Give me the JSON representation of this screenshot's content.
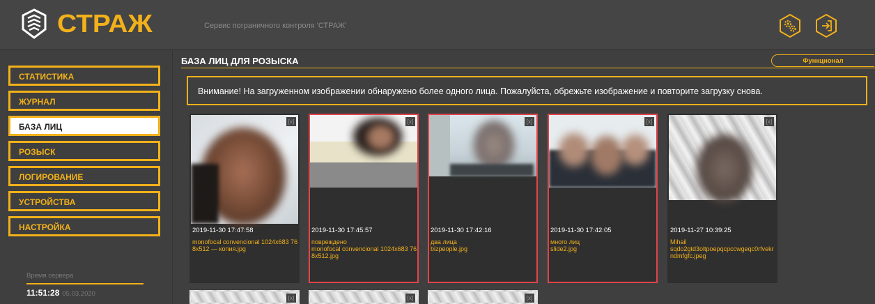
{
  "header": {
    "brand": "СТРАЖ",
    "service_title": "Сервис пограничного контроля 'СТРАЖ'",
    "icons": [
      "settings-gears-icon",
      "logout-icon"
    ]
  },
  "sidebar": {
    "items": [
      {
        "label": "СТАТИСТИКА",
        "active": false
      },
      {
        "label": "ЖУРНАЛ",
        "active": false
      },
      {
        "label": "БАЗА ЛИЦ",
        "active": true
      },
      {
        "label": "РОЗЫСК",
        "active": false
      },
      {
        "label": "ЛОГИРОВАНИЕ",
        "active": false
      },
      {
        "label": "УСТРОЙСТВА",
        "active": false
      },
      {
        "label": "НАСТРОЙКА",
        "active": false
      }
    ],
    "server_time_label": "Время сервера",
    "server_time": "11:51:28",
    "server_date": "05.03.2020"
  },
  "main": {
    "title": "БАЗА ЛИЦ ДЛЯ РОЗЫСКА",
    "functional_button": "Функционал",
    "warning": "Внимание! На загруженном изображении обнаружено более одного лица. Пожалуйста, обрежьте изображение и повторите загрузку снова.",
    "close_label": "[x]",
    "cards": [
      {
        "date": "2019-11-30 17:47:58",
        "status": "",
        "file": "monofocal convencional 1024x683 768x512 — копия.jpg",
        "error": false
      },
      {
        "date": "2019-11-30 17:45:57",
        "status": "повреждено",
        "file": "monofocal convencional 1024x683 768x512.jpg",
        "error": true
      },
      {
        "date": "2019-11-30 17:42:16",
        "status": "два лица",
        "file": "bizpeople.jpg",
        "error": true
      },
      {
        "date": "2019-11-30 17:42:05",
        "status": "много лиц",
        "file": "slide2.jpg",
        "error": true
      },
      {
        "date": "2019-11-27 10:39:25",
        "status": "Mihail",
        "file": "sqdo2gtd3oltpoepqcpccwgeqc0rfvekrndmfgfc.jpeg",
        "error": false
      }
    ]
  },
  "colors": {
    "accent": "#f2b11a",
    "error": "#e0454a",
    "background": "#3f3f3f"
  }
}
